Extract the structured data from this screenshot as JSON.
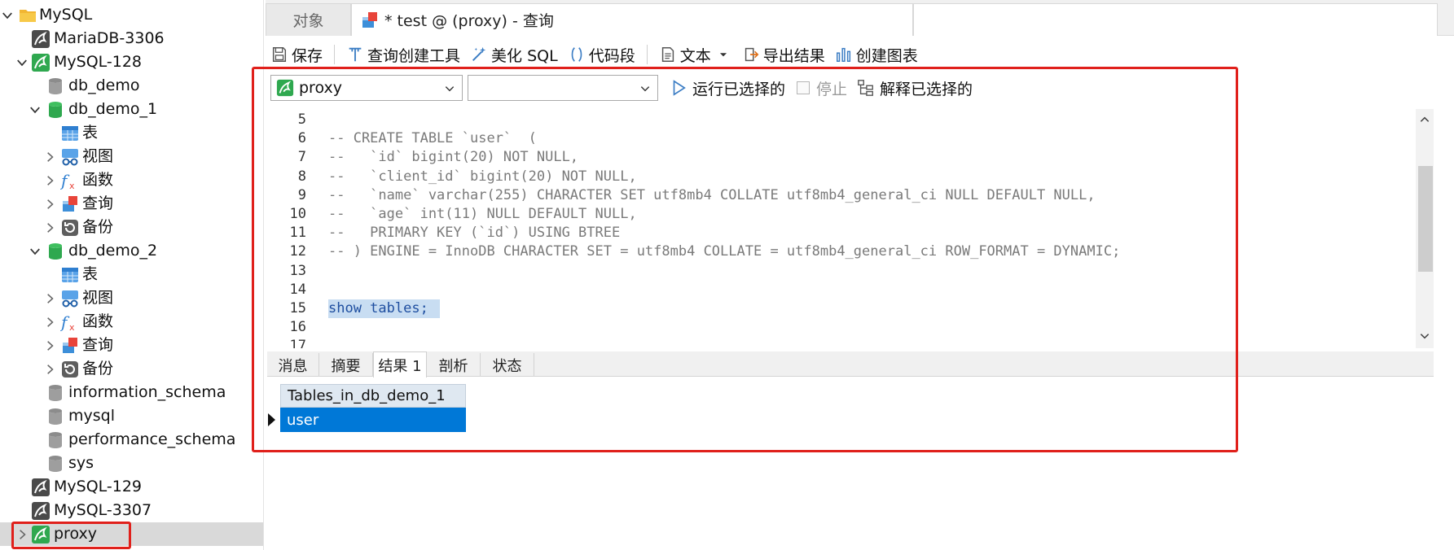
{
  "sidebar": {
    "items": [
      {
        "label": "MySQL",
        "icon": "folder-icon"
      },
      {
        "label": "MariaDB-3306",
        "icon": "connection-icon"
      },
      {
        "label": "MySQL-128",
        "icon": "connection-active-icon"
      },
      {
        "label": "db_demo",
        "icon": "database-icon"
      },
      {
        "label": "db_demo_1",
        "icon": "database-open-icon"
      },
      {
        "label": "表",
        "icon": "table-icon"
      },
      {
        "label": "视图",
        "icon": "view-icon"
      },
      {
        "label": "函数",
        "icon": "function-icon"
      },
      {
        "label": "查询",
        "icon": "query-icon"
      },
      {
        "label": "备份",
        "icon": "backup-icon"
      },
      {
        "label": "db_demo_2",
        "icon": "database-open-icon"
      },
      {
        "label": "表",
        "icon": "table-icon"
      },
      {
        "label": "视图",
        "icon": "view-icon"
      },
      {
        "label": "函数",
        "icon": "function-icon"
      },
      {
        "label": "查询",
        "icon": "query-icon"
      },
      {
        "label": "备份",
        "icon": "backup-icon"
      },
      {
        "label": "information_schema",
        "icon": "database-icon"
      },
      {
        "label": "mysql",
        "icon": "database-icon"
      },
      {
        "label": "performance_schema",
        "icon": "database-icon"
      },
      {
        "label": "sys",
        "icon": "database-icon"
      },
      {
        "label": "MySQL-129",
        "icon": "connection-icon"
      },
      {
        "label": "MySQL-3307",
        "icon": "connection-icon"
      },
      {
        "label": "proxy",
        "icon": "connection-active-icon"
      }
    ]
  },
  "tabs": {
    "objects": "对象",
    "query": "* test @ (proxy) - 查询"
  },
  "toolbar": {
    "save": "保存",
    "query_builder": "查询创建工具",
    "beautify": "美化 SQL",
    "snippet": "代码段",
    "text": "文本",
    "export": "导出结果",
    "create_chart": "创建图表"
  },
  "querybar": {
    "connection": "proxy",
    "database": "",
    "run_selected": "运行已选择的",
    "stop": "停止",
    "explain_selected": "解释已选择的"
  },
  "editor": {
    "lines": [
      {
        "num": "5",
        "text": ""
      },
      {
        "num": "6",
        "text": "-- CREATE TABLE `user`  ("
      },
      {
        "num": "7",
        "text": "--   `id` bigint(20) NOT NULL,"
      },
      {
        "num": "8",
        "text": "--   `client_id` bigint(20) NOT NULL,"
      },
      {
        "num": "9",
        "text": "--   `name` varchar(255) CHARACTER SET utf8mb4 COLLATE utf8mb4_general_ci NULL DEFAULT NULL,"
      },
      {
        "num": "10",
        "text": "--   `age` int(11) NULL DEFAULT NULL,"
      },
      {
        "num": "11",
        "text": "--   PRIMARY KEY (`id`) USING BTREE"
      },
      {
        "num": "12",
        "text": "-- ) ENGINE = InnoDB CHARACTER SET = utf8mb4 COLLATE = utf8mb4_general_ci ROW_FORMAT = DYNAMIC;"
      },
      {
        "num": "13",
        "text": ""
      },
      {
        "num": "14",
        "text": ""
      },
      {
        "num": "15",
        "text": "show tables;"
      },
      {
        "num": "16",
        "text": ""
      },
      {
        "num": "17",
        "text": ""
      }
    ]
  },
  "results": {
    "tabs": [
      "消息",
      "摘要",
      "结果 1",
      "剖析",
      "状态"
    ],
    "active_tab": "结果 1",
    "column": "Tables_in_db_demo_1",
    "rows": [
      "user"
    ]
  },
  "colors": {
    "accent": "#0078d7",
    "annotation": "#e0201b",
    "connection_green": "#2fa84f",
    "selection_highlight": "#c8ddf2"
  }
}
